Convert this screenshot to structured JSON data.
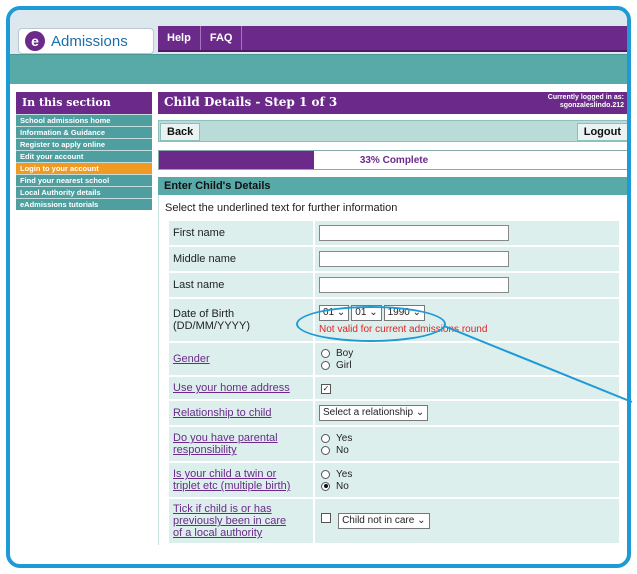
{
  "logo": {
    "letter": "e",
    "text": "Admissions"
  },
  "nav": [
    "Help",
    "FAQ"
  ],
  "sidebar": {
    "heading": "In this section",
    "items": [
      "School admissions home",
      "Information & Guidance",
      "Register to apply online",
      "Edit your account",
      "Login to your account",
      "Find your nearest school",
      "Local Authority details",
      "eAdmissions tutorials"
    ],
    "active_index": 4
  },
  "page": {
    "title": "Child Details - Step 1 of 3",
    "login_line1": "Currently logged in as:",
    "login_line2": "sgonzaleslindo.212",
    "back_label": "Back",
    "logout_label": "Logout",
    "progress_label": "33% Complete",
    "progress_fraction": 0.33,
    "section_heading": "Enter Child's Details",
    "instructions": "Select the underlined text for further information"
  },
  "form": {
    "first_name": "First name",
    "middle_name": "Middle name",
    "last_name": "Last name",
    "dob_label1": "Date of Birth",
    "dob_label2": "(DD/MM/YYYY)",
    "dob_day": "01",
    "dob_month": "01",
    "dob_year": "1990",
    "dob_error": "Not valid for current admissions round",
    "gender_label": "Gender",
    "gender_boy": "Boy",
    "gender_girl": "Girl",
    "home_address_label": "Use your home address",
    "relationship_label": "Relationship to child",
    "relationship_value": "Select a relationship",
    "parental_label1": "Do you have parental",
    "parental_label2": "responsibility",
    "yes": "Yes",
    "no": "No",
    "twin_label1": "Is your child a twin or",
    "twin_label2": "triplet etc (multiple birth)",
    "care_label1": "Tick if child is or has",
    "care_label2": "previously been in care",
    "care_label3": "of a local authority",
    "care_value": "Child not in care"
  },
  "colors": {
    "purple": "#6b2a8a",
    "teal": "#58aaa8",
    "orange": "#f09a24",
    "frame_blue": "#1e9ad6"
  }
}
